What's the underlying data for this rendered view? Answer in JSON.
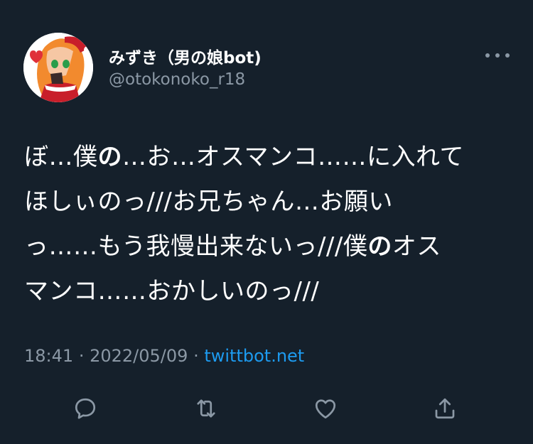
{
  "tweet": {
    "display_name": "みずき（男の娘bot)",
    "handle": "@otokonoko_r18",
    "lines": [
      [
        "ぼ…僕",
        "の",
        "…お…オスマンコ……に入れて"
      ],
      [
        "ほしぃのっ///お兄ちゃん…お願い",
        "",
        ""
      ],
      [
        "っ……もう我慢出来ないっ///僕",
        "の",
        "オス"
      ],
      [
        "マンコ……おかしいのっ///",
        "",
        ""
      ]
    ],
    "time": "18:41",
    "separator_1": "·",
    "date": "2022/05/09",
    "separator_2": "·",
    "source": "twittbot.net"
  },
  "actions": {
    "reply": "reply-icon",
    "retweet": "retweet-icon",
    "like": "heart-icon",
    "share": "share-icon"
  },
  "colors": {
    "background": "#15202b",
    "text": "#ffffff",
    "muted": "#8b98a5",
    "link": "#1d9bf0"
  }
}
